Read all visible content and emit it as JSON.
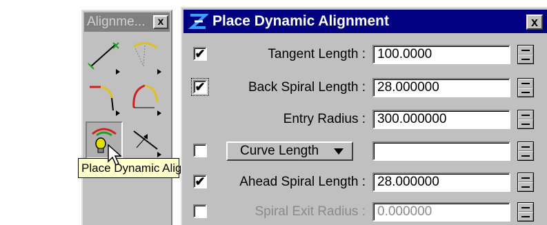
{
  "toolbox": {
    "title": "Alignme...",
    "close_label": "x",
    "tools": [
      {
        "name": "line-tool-icon"
      },
      {
        "name": "arc-tool-icon"
      },
      {
        "name": "spiral-corner-tool-icon"
      },
      {
        "name": "spiral-arc-tool-icon"
      },
      {
        "name": "place-dynamic-alignment-icon"
      },
      {
        "name": "arrow-line-tool-icon"
      }
    ],
    "tooltip": "Place Dynamic Alignment"
  },
  "dialog": {
    "title": "Place Dynamic Alignment",
    "close_label": "x",
    "rows": [
      {
        "checked": true,
        "label": "Tangent Length :",
        "value": "100.0000"
      },
      {
        "checked": true,
        "label": "Back Spiral Length :",
        "value": "28.000000"
      },
      {
        "label": "Entry Radius :",
        "value": "300.000000"
      },
      {
        "checked": false,
        "dropdown": "Curve Length",
        "value": ""
      },
      {
        "checked": true,
        "label": "Ahead Spiral Length :",
        "value": "28.000000"
      },
      {
        "checked": false,
        "label": "Spiral Exit Radius :",
        "value": "0.000000",
        "disabled": true
      }
    ]
  },
  "check_mark": "✔",
  "colors": {
    "title_bar": "#000080",
    "panel": "#c0c0c0",
    "tooltip_bg": "#ffffcc"
  }
}
